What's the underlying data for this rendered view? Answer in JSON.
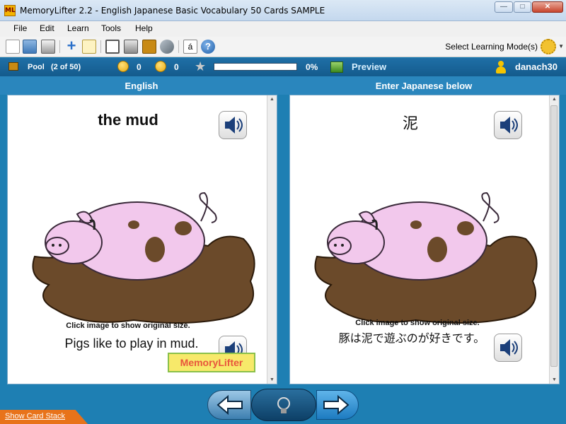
{
  "window": {
    "app_icon_text": "ML",
    "title": "MemoryLifter 2.2 - English Japanese Basic Vocabulary 50 Cards SAMPLE",
    "buttons": [
      "minimize",
      "maximize",
      "close"
    ]
  },
  "menu": [
    "File",
    "Edit",
    "Learn",
    "Tools",
    "Help"
  ],
  "toolbar": {
    "icons": [
      "new-icon",
      "open-icon",
      "print-icon",
      "add-card-icon",
      "edit-icon",
      "slideshow-icon",
      "card-editor-icon",
      "card-stack-icon",
      "tools-icon",
      "character-map-icon",
      "help-icon"
    ],
    "mode_label": "Select Learning Mode(s)",
    "mode_icon": "gear-icon"
  },
  "status": {
    "pool_label": "Pool",
    "pool_count": "(2 of 50)",
    "correct_count": "0",
    "wrong_count": "0",
    "progress_percent": 0,
    "progress_label": "0%",
    "preview_label": "Preview",
    "user": "danach30"
  },
  "headers": {
    "left": "English",
    "right": "Enter Japanese below"
  },
  "question": {
    "word": "the mud",
    "hint": "Click image to show original size.",
    "sentence": "Pigs like to play in mud.",
    "watermark": "MemoryLifter"
  },
  "answer": {
    "word": "泥",
    "hint": "Click image to show original size.",
    "sentence": "豚は泥で遊ぶのが好きです。"
  },
  "nav": {
    "prev_icon": "arrow-left-icon",
    "hint_icon": "lightbulb-icon",
    "next_icon": "arrow-right-icon"
  },
  "show_card_stack": "Show Card Stack",
  "colors": {
    "app_background": "#1e7fb3",
    "status_bar": "#145b8d",
    "panel_border": "#7aa8c8",
    "mud": "#6b4a2a",
    "pig": "#f2c8ec",
    "show_stack": "#e8731a"
  }
}
